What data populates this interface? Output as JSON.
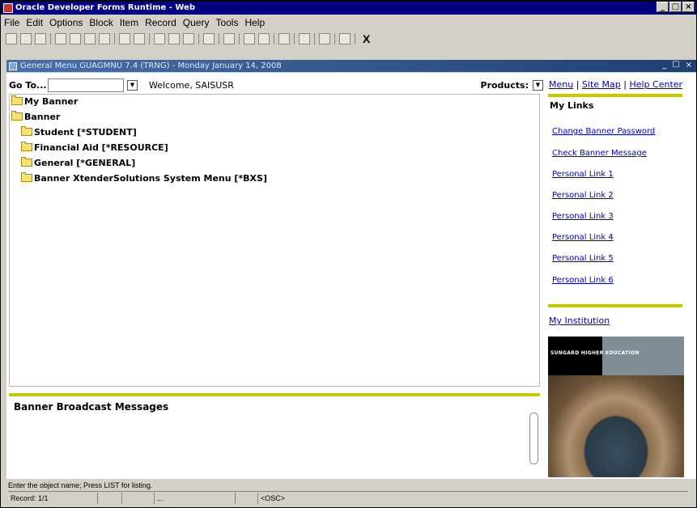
{
  "window": {
    "title": "Oracle Developer Forms Runtime - Web",
    "min_label": "_",
    "max_label": "□",
    "close_label": "×"
  },
  "menu": [
    "File",
    "Edit",
    "Options",
    "Block",
    "Item",
    "Record",
    "Query",
    "Tools",
    "Help"
  ],
  "toolbar": {
    "exit_label": "X"
  },
  "form": {
    "title": "General Menu  GUAGMNU  7.4  (TRNG) - Monday January 14, 2008",
    "controls": "_ ☐ ×"
  },
  "goto": {
    "label": "Go To...",
    "welcome": "Welcome, SAISUSR"
  },
  "products": {
    "label": "Products:"
  },
  "tree": {
    "my_banner": "My Banner",
    "banner": "Banner",
    "children": [
      "Student [*STUDENT]",
      "Financial Aid [*RESOURCE]",
      "General [*GENERAL]",
      "Banner XtenderSolutions System Menu [*BXS]"
    ]
  },
  "broadcast": {
    "title": "Banner Broadcast Messages"
  },
  "sidebar": {
    "nav": {
      "menu": "Menu",
      "sep": "|",
      "sitemap": "Site Map",
      "help": "Help Center"
    },
    "my_links_title": "My Links",
    "links": [
      "Change Banner Password",
      "Check Banner Message",
      "Personal Link 1",
      "Personal Link 2",
      "Personal Link 3",
      "Personal Link 4",
      "Personal Link 5",
      "Personal Link 6"
    ],
    "institution": "My Institution",
    "promo": {
      "brand": "SUNGARD",
      "text": "HIGHER EDUCATION"
    },
    "colors": {
      "accent_bar": "#c8c800",
      "link": "#0000cc"
    }
  },
  "status": {
    "hint": "Enter the object name; Press LIST for listing.",
    "record": "Record: 1/1",
    "ellipsis": "...",
    "osc": "<OSC>"
  }
}
